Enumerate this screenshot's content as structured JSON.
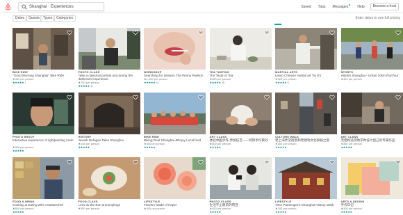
{
  "nav": {
    "search_value": "Shanghai · Experiences",
    "links": [
      "Saved",
      "Trips",
      "Messages",
      "Help"
    ],
    "host_button": "Become a host"
  },
  "filters": {
    "buttons": [
      "Dates",
      "Guests",
      "Types",
      "Categories"
    ],
    "hint": "Enter dates to see full pricing"
  },
  "colors": {
    "brand": "#ff5a5f",
    "teal": "#00a699",
    "stars": "#008489"
  },
  "cards": [
    {
      "category": "BIKE RIDE",
      "title": "\"Good Morning Shanghai\" Bike Ride",
      "price": "★400 per person",
      "rating": "★★★★★",
      "reviews": "1",
      "scene": "street"
    },
    {
      "category": "PHOTO CLASS",
      "title": "Take a classical portrait and during the darkroom experience",
      "price": "★750 per person",
      "rating": "★★★★★",
      "reviews": "11",
      "scene": "photographer"
    },
    {
      "category": "WORKSHOP",
      "title": "Searching for Dreams The Peony Pavilion",
      "price": "★1,200 per person",
      "rating": "★★★★★",
      "reviews": "12",
      "scene": "lips"
    },
    {
      "category": "TEA TASTING",
      "title": "The Taste of Tea",
      "price": "★350 per person",
      "rating": "★★★★★",
      "reviews": "16",
      "scene": "tea"
    },
    {
      "category": "MARTIAL ARTS",
      "title": "Learn Chinese martial art Tai chi",
      "price": "★300 per person",
      "rating": "★★★★★",
      "reviews": "5",
      "scene": "taichi"
    },
    {
      "category": "SPORTS",
      "title": "Hidden Shanghai - Urban 10km RunTour",
      "price": "★400 per person",
      "rating": "",
      "reviews": "",
      "scene": "runners"
    },
    {
      "category": "PHOTO SHOOT",
      "title": "Interactive experience of lightpainting room",
      "price": "★350 per person",
      "rating": "★★★★★",
      "reviews": "",
      "scene": "portrait"
    },
    {
      "category": "HISTORY",
      "title": "Jewish Refugee Tales Shanghai",
      "price": "★106 per person",
      "rating": "★★★★★",
      "reviews": "",
      "scene": "gate"
    },
    {
      "category": "BIKE RIDE",
      "title": "Biking Real Shanghai &Enjoy Local food",
      "price": "★300 per person",
      "rating": "★★★★★",
      "reviews": "",
      "scene": "group"
    },
    {
      "category": "ART CLASS",
      "title": "体验中国手作·传统技艺——玩转手作紫砂",
      "price": "★500 per person",
      "rating": "★★★★★",
      "reviews": "",
      "scene": "clay"
    },
    {
      "category": "CULTURE WALK",
      "title": "老上海弄堂街景和老建筑文化探秘之旅",
      "price": "★300 per person",
      "rating": "★★★★★",
      "reviews": "",
      "scene": "lane"
    },
    {
      "category": "ART CLASS",
      "title": "无需构造得地学你设计自己的专属作品",
      "price": "★380 per person",
      "rating": "★★★★★",
      "reviews": "",
      "scene": "workshop"
    },
    {
      "category": "FOOD & DRINK",
      "title": "Cooking & Eating with a Masterchef",
      "price": "★550 per person",
      "rating": "★★★★★",
      "reviews": "",
      "scene": "chef"
    },
    {
      "category": "FOOD CLASS",
      "title": "Let's do the Bun & Dumplings",
      "price": "★300 per person",
      "rating": "",
      "reviews": "",
      "scene": "dumpling"
    },
    {
      "category": "LIFESTYLE",
      "title": "Flowers Made of Paper",
      "price": "★300 per person",
      "rating": "",
      "reviews": "",
      "scene": "flower"
    },
    {
      "category": "PHOTO CLASS",
      "title": "生活不止眼前的苟且",
      "price": "★450 per person",
      "rating": "★★★★★",
      "reviews": "",
      "scene": "camera"
    },
    {
      "category": "LIFESTYLE",
      "title": "Time Passenger's Shanghai History Walk",
      "price": "★200 per person",
      "rating": "★★★★★",
      "reviews": "",
      "scene": "temple"
    },
    {
      "category": "ARTS & DESIGN",
      "title": "手作日记",
      "price": "★300 per person",
      "rating": "★★★★★",
      "reviews": "",
      "scene": "paper"
    }
  ]
}
